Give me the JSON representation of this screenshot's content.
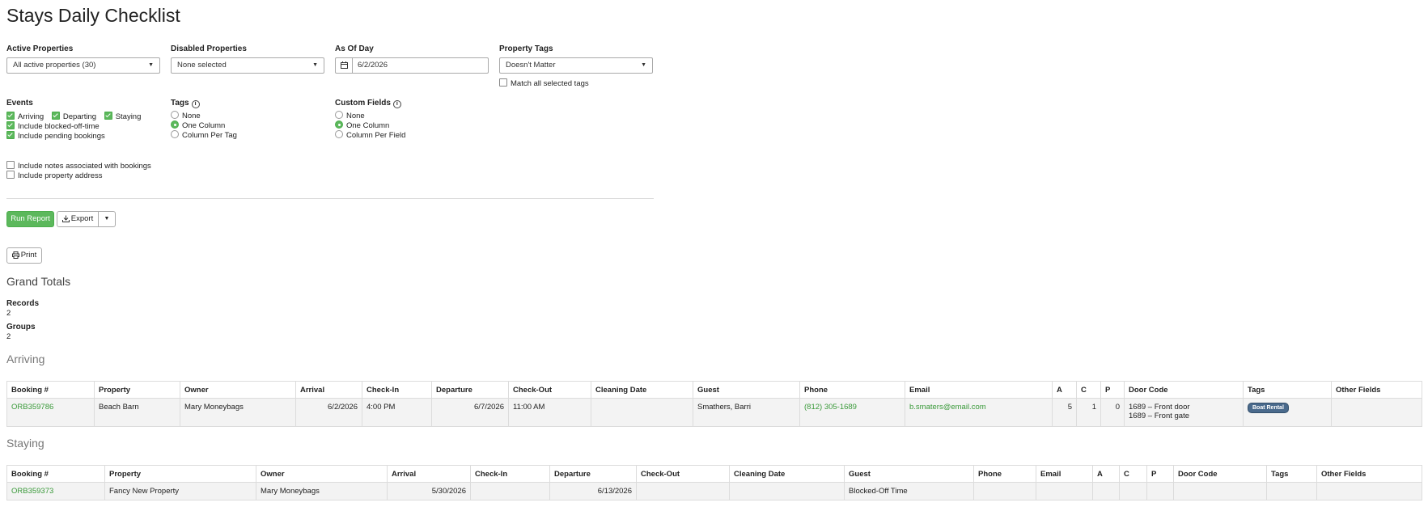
{
  "page_title": "Stays Daily Checklist",
  "filters": {
    "active_properties": {
      "label": "Active Properties",
      "value": "All active properties (30)"
    },
    "disabled_properties": {
      "label": "Disabled Properties",
      "value": "None selected"
    },
    "as_of_day": {
      "label": "As Of Day",
      "value": "6/2/2026"
    },
    "property_tags": {
      "label": "Property Tags",
      "value": "Doesn't Matter",
      "match_all_label": "Match all selected tags"
    }
  },
  "events": {
    "label": "Events",
    "arriving": "Arriving",
    "departing": "Departing",
    "staying": "Staying",
    "blocked": "Include blocked-off-time",
    "pending": "Include pending bookings"
  },
  "tags_opt": {
    "label": "Tags",
    "none": "None",
    "one_column": "One Column",
    "column_per": "Column Per Tag"
  },
  "custom_fields": {
    "label": "Custom Fields",
    "none": "None",
    "one_column": "One Column",
    "column_per": "Column Per Field"
  },
  "extra_options": {
    "notes": "Include notes associated with bookings",
    "address": "Include property address"
  },
  "actions": {
    "run": "Run Report",
    "export": "Export",
    "print": "Print"
  },
  "grand_totals": {
    "title": "Grand Totals",
    "records_label": "Records",
    "records_value": "2",
    "groups_label": "Groups",
    "groups_value": "2"
  },
  "columns": [
    "Booking #",
    "Property",
    "Owner",
    "Arrival",
    "Check-In",
    "Departure",
    "Check-Out",
    "Cleaning Date",
    "Guest",
    "Phone",
    "Email",
    "A",
    "C",
    "P",
    "Door Code",
    "Tags",
    "Other Fields"
  ],
  "arriving": {
    "title": "Arriving",
    "row": {
      "booking": "ORB359786",
      "property": "Beach Barn",
      "owner": "Mary Moneybags",
      "arrival": "6/2/2026",
      "checkin": "4:00 PM",
      "departure": "6/7/2026",
      "checkout": "11:00 AM",
      "cleaning": "",
      "guest": "Smathers, Barri",
      "phone": "(812) 305-1689",
      "email": "b.smaters@email.com",
      "a": "5",
      "c": "1",
      "p": "0",
      "door1": "1689 – Front door",
      "door2": "1689 – Front gate",
      "tag": "Boat Rental",
      "other": ""
    }
  },
  "staying": {
    "title": "Staying",
    "row": {
      "booking": "ORB359373",
      "property": "Fancy New Property",
      "owner": "Mary Moneybags",
      "arrival": "5/30/2026",
      "checkin": "",
      "departure": "6/13/2026",
      "checkout": "",
      "cleaning": "",
      "guest": "Blocked-Off Time",
      "phone": "",
      "email": "",
      "a": "",
      "c": "",
      "p": "",
      "door": "",
      "tags": "",
      "other": ""
    }
  }
}
